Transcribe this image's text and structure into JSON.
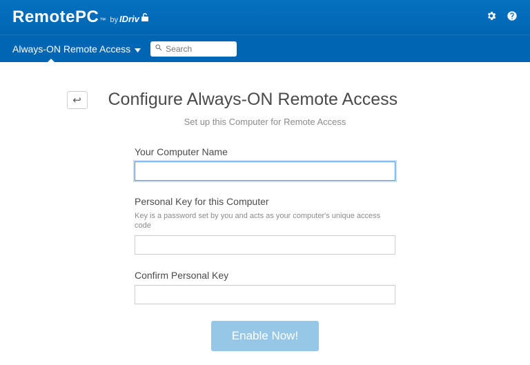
{
  "header": {
    "logo_main": "RemotePC",
    "logo_tm": "™",
    "logo_by": "by",
    "logo_idrive": "IDriv"
  },
  "subheader": {
    "nav_label": "Always-ON Remote Access",
    "search_placeholder": "Search"
  },
  "page": {
    "title": "Configure Always-ON Remote Access",
    "subtitle": "Set up this Computer for Remote Access",
    "back_glyph": "↩"
  },
  "form": {
    "computer_name_label": "Your Computer Name",
    "computer_name_value": "",
    "personal_key_label": "Personal Key for this Computer",
    "personal_key_hint": "Key is a password set by you and acts as your computer's unique access code",
    "personal_key_value": "",
    "confirm_key_label": "Confirm Personal Key",
    "confirm_key_value": "",
    "submit_label": "Enable Now!"
  }
}
